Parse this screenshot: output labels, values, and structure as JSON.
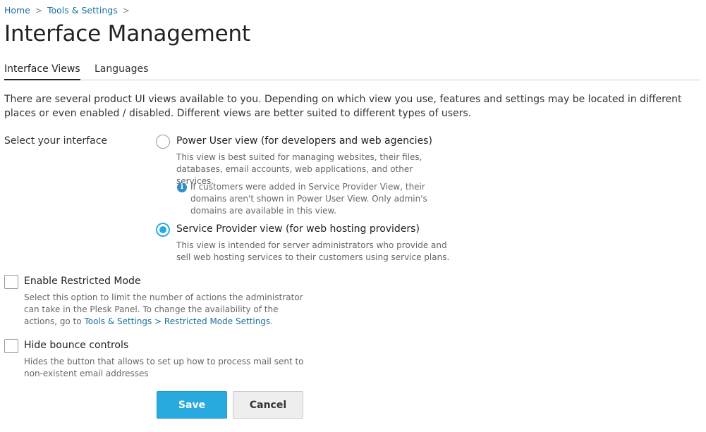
{
  "breadcrumb": {
    "home": "Home",
    "tools": "Tools & Settings",
    "separator": ">"
  },
  "page_title": "Interface Management",
  "tabs": [
    {
      "label": "Interface Views",
      "active": true
    },
    {
      "label": "Languages",
      "active": false
    }
  ],
  "intro": "There are several product UI views available to you. Depending on which view you use, features and settings may be located in different places or even enabled / disabled. Different views are better suited to different types of users.",
  "form": {
    "select_label": "Select your interface",
    "power_user": {
      "label": "Power User view (for developers and web agencies)",
      "hint": "This view is best suited for managing websites, their files, databases, email accounts, web applications, and other services.",
      "info": "If customers were added in Service Provider View, their domains aren't shown in Power User View. Only admin's domains are available in this view.",
      "checked": false
    },
    "service_provider": {
      "label": "Service Provider view (for web hosting providers)",
      "hint": "This view is intended for server administrators who provide and sell web hosting services to their customers using service plans.",
      "checked": true
    },
    "restricted_mode": {
      "label": "Enable Restricted Mode",
      "hint": "Select this option to limit the number of actions the administrator can take in the Plesk Panel. To change the availability of the actions, go to",
      "link": "Tools & Settings > Restricted Mode Settings",
      "link_suffix": ".",
      "checked": false
    },
    "bounce": {
      "label": "Hide bounce controls",
      "hint": "Hides the button that allows to set up how to process mail sent to non-existent email addresses",
      "checked": false
    }
  },
  "buttons": {
    "save": "Save",
    "cancel": "Cancel"
  },
  "icons": {
    "info": "info-icon",
    "chevron": "chevron-right-icon"
  },
  "colors": {
    "accent": "#28aade",
    "link": "#1a6fa0"
  }
}
